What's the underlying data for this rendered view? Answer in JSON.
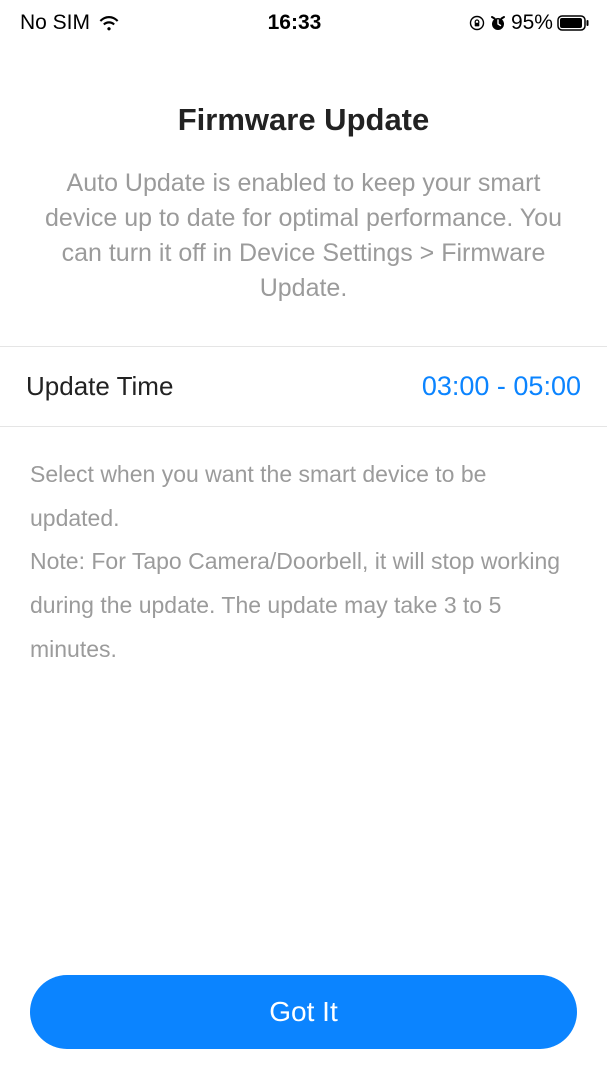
{
  "status_bar": {
    "sim": "No SIM",
    "time": "16:33",
    "battery_pct": "95%"
  },
  "header": {
    "title": "Firmware Update",
    "subtitle": "Auto Update is enabled to keep your smart device up to date for optimal performance. You can turn it off in Device Settings > Firmware Update."
  },
  "update_time_row": {
    "label": "Update Time",
    "value": "03:00 - 05:00"
  },
  "description": {
    "line1": "Select when you want the smart device to be updated.",
    "line2": "Note: For Tapo Camera/Doorbell, it will stop working during the update. The update may take 3 to 5 minutes."
  },
  "footer": {
    "got_it": "Got It"
  }
}
